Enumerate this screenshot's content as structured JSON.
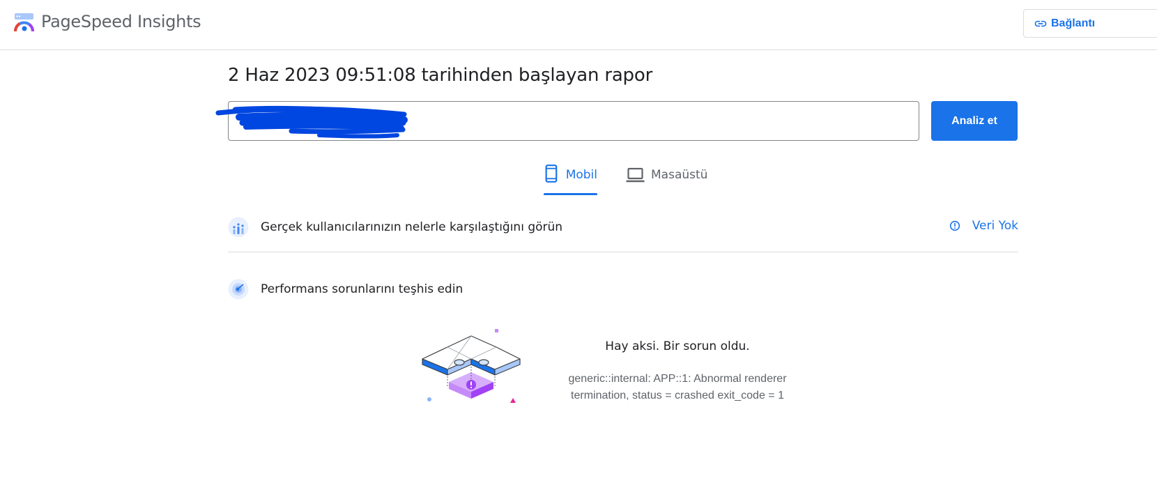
{
  "header": {
    "app_title": "PageSpeed Insights",
    "copy_link_label": "Bağlantı"
  },
  "report": {
    "title": "2 Haz 2023 09:51:08 tarihinden başlayan rapor"
  },
  "search": {
    "url_value": "",
    "analyze_label": "Analiz et"
  },
  "tabs": [
    {
      "label": "Mobil",
      "selected": true
    },
    {
      "label": "Masaüstü",
      "selected": false
    }
  ],
  "sections": {
    "crux": {
      "text": "Gerçek kullanıcılarınızın nelerle karşılaştığını görün",
      "no_data_label": "Veri Yok"
    },
    "lab": {
      "text": "Performans sorunlarını teşhis edin"
    }
  },
  "error": {
    "title": "Hay aksi. Bir sorun oldu.",
    "line1": "generic::internal: APP::1: Abnormal renderer",
    "line2": "termination, status = crashed exit_code = 1"
  },
  "colors": {
    "accent": "#1a73e8",
    "text_primary": "#202124",
    "text_secondary": "#5f6368",
    "divider": "#dadce0",
    "redaction": "#0046e0"
  }
}
